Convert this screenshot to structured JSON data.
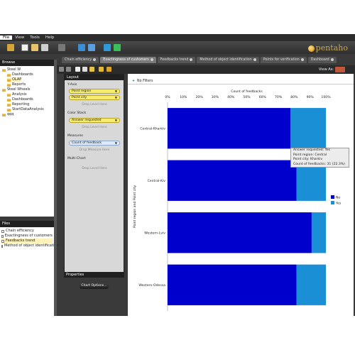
{
  "menu": [
    "File",
    "View",
    "Tools",
    "Help"
  ],
  "logo_text": "pentaho",
  "browse": {
    "title": "Browse",
    "tree": [
      {
        "label": "Steel W",
        "icon": "folder-icon",
        "indent": 0
      },
      {
        "label": "Dashboards",
        "icon": "folder-icon",
        "indent": 1
      },
      {
        "label": "OLAP",
        "icon": "folder-icon",
        "indent": 1,
        "selected": true
      },
      {
        "label": "Reports",
        "icon": "folder-icon",
        "indent": 1
      },
      {
        "label": "Steel Wheels",
        "icon": "folder-icon",
        "indent": 0
      },
      {
        "label": "Analysis",
        "icon": "folder-icon",
        "indent": 1
      },
      {
        "label": "Dashboards",
        "icon": "folder-icon",
        "indent": 1
      },
      {
        "label": "Reporting",
        "icon": "folder-icon",
        "indent": 1
      },
      {
        "label": "StartDataAnalysis",
        "icon": "folder-icon",
        "indent": 1
      },
      {
        "label": "qqq",
        "icon": "folder-icon",
        "indent": 0
      }
    ]
  },
  "files": {
    "title": "Files",
    "items": [
      {
        "label": "Chain efficiency",
        "selected": false
      },
      {
        "label": "Exactingness of customers",
        "selected": false
      },
      {
        "label": "Feedbacks trend",
        "selected": true
      },
      {
        "label": "Method of object identification",
        "selected": false
      }
    ]
  },
  "tabs": [
    {
      "label": "Chain efficiency",
      "active": false
    },
    {
      "label": "Exactingness of customers",
      "active": true
    },
    {
      "label": "Feedbacks trend",
      "active": false
    },
    {
      "label": "Method of object identification",
      "active": false
    },
    {
      "label": "Points for verification",
      "active": false
    },
    {
      "label": "Dashboard",
      "active": false
    }
  ],
  "view_as": "View As:",
  "layout": {
    "title": "Layout",
    "y_axis_label": "Y-Axis",
    "y_axis_fields": [
      "Point region",
      "Point city"
    ],
    "drop_level": "Drop Level Here",
    "color_stack_label": "Color Stack",
    "color_stack_fields": [
      "Answer requested"
    ],
    "measures_label": "Measures",
    "measures_fields": [
      "Count of feedback"
    ],
    "drop_measure": "Drop Measure Here",
    "multi_chart_label": "Multi-Chart"
  },
  "properties": {
    "title": "Properties",
    "chart_options": "Chart Options..."
  },
  "filter_bar": {
    "label": "No Filters"
  },
  "tooltip": {
    "lines": [
      "Answer requested: Yes",
      "Point region: Central",
      "Point city: Kharkiv",
      "Count of feedbacks: 31 (22.3%)"
    ]
  },
  "chart_data": {
    "type": "bar",
    "orientation": "horizontal",
    "stacked": "percent",
    "xlabel": "Count of feedbacks",
    "ylabel": "Point region and Point city",
    "xticks": [
      "0%",
      "10%",
      "20%",
      "30%",
      "40%",
      "50%",
      "60%",
      "70%",
      "80%",
      "90%",
      "100%"
    ],
    "xlim": [
      0,
      100
    ],
    "categories": [
      "Central-Kharkiv",
      "Central-Kiv",
      "Western-Lviv",
      "Western-Odessa"
    ],
    "series": [
      {
        "name": "No",
        "color": "#0000cc",
        "values": [
          77.7,
          81.5,
          91.0,
          81.5
        ]
      },
      {
        "name": "Yes",
        "color": "#1a8fd6",
        "values": [
          22.3,
          18.5,
          9.0,
          18.5
        ]
      }
    ],
    "legend_position": "right"
  }
}
